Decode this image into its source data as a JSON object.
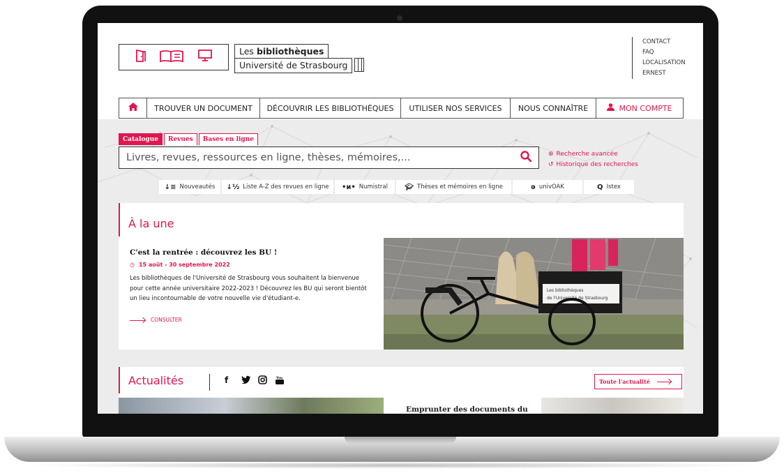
{
  "logo": {
    "icons": [
      "door-icon",
      "book-icon",
      "computer-icon"
    ],
    "line1_prefix": "Les",
    "line1_bold": "bibliothèques",
    "line2": "Université de Strasbourg"
  },
  "top_links": [
    "CONTACT",
    "FAQ",
    "LOCALISATION",
    "ERNEST"
  ],
  "nav": {
    "home_icon": "home-icon",
    "items": [
      "TROUVER UN DOCUMENT",
      "DÉCOUVRIR LES BIBLIOTHÈQUES",
      "UTILISER NOS SERVICES",
      "NOUS CONNAÎTRE"
    ],
    "account_label": "MON COMPTE",
    "account_icon": "user-icon"
  },
  "search": {
    "tabs": [
      "Catalogue",
      "Revues",
      "Bases en ligne"
    ],
    "active_tab": "Catalogue",
    "placeholder": "Livres, revues, ressources en ligne, thèses, mémoires,...",
    "value": "",
    "advanced": "Recherche avancée",
    "history": "Historique des recherches"
  },
  "quick_links": [
    {
      "icon": "sort-icon",
      "label": "Nouveautés"
    },
    {
      "icon": "sort-az-icon",
      "label": "Liste A-Z des revues en ligne"
    },
    {
      "icon": "numistral-icon",
      "label": "Numistral"
    },
    {
      "icon": "graduation-cap-icon",
      "label": "Thèses et mémoires en ligne"
    },
    {
      "icon": "open-access-icon",
      "label": "univOAK"
    },
    {
      "icon": "istex-icon",
      "label": "Istex"
    }
  ],
  "une": {
    "heading": "À la une",
    "article": {
      "title": "C'est la rentrée : découvrez les BU !",
      "dates": "15 août - 30 septembre 2022",
      "text": "Les bibliothèques de l'Université de Strasbourg vous souhaitent la bienvenue pour cette année universitaire 2022-2023 ! Découvrez les BU qui seront bientôt un lieu incontournable de votre nouvelle vie d'étudiant-e.",
      "link": "CONSULTER",
      "photo_sign_line1": "Les bibliothèques",
      "photo_sign_line2": "de l'Université de Strasbourg"
    }
  },
  "actualites": {
    "heading": "Actualités",
    "social": [
      "facebook-icon",
      "twitter-icon",
      "instagram-icon",
      "youtube-icon"
    ],
    "all_link": "Toute l'actualité",
    "card_title": "Emprunter des documents du"
  },
  "colors": {
    "accent": "#e0164e",
    "background": "#ececec"
  }
}
